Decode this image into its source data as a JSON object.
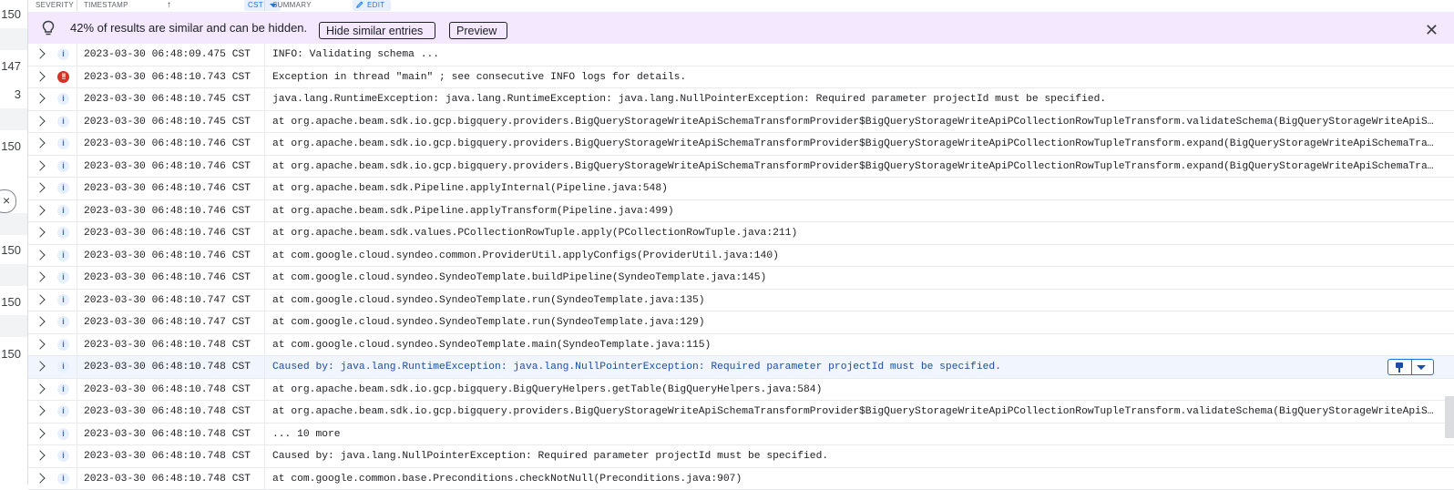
{
  "left_column": {
    "items": [
      "150",
      "147",
      "3",
      "150",
      "150",
      "150",
      "150"
    ],
    "close_glyph": "×"
  },
  "header": {
    "severity": "SEVERITY",
    "timestamp": "TIMESTAMP",
    "sort_glyph": "↑",
    "timezone": "CST",
    "summary": "SUMMARY",
    "edit": "EDIT"
  },
  "banner": {
    "text": "42% of results are similar and can be hidden.",
    "hide_label": "Hide similar entries",
    "preview_label": "Preview",
    "close_glyph": "✕"
  },
  "rows": [
    {
      "severity": "i",
      "timestamp": "2023-03-30 06:48:09.475 CST",
      "message": "INFO: Validating schema ..."
    },
    {
      "severity": "!!",
      "timestamp": "2023-03-30 06:48:10.743 CST",
      "message": "Exception in thread \"main\" ; see consecutive INFO logs for details."
    },
    {
      "severity": "i",
      "timestamp": "2023-03-30 06:48:10.745 CST",
      "message": "java.lang.RuntimeException: java.lang.RuntimeException: java.lang.NullPointerException: Required parameter projectId must be specified."
    },
    {
      "severity": "i",
      "timestamp": "2023-03-30 06:48:10.745 CST",
      "message": " at org.apache.beam.sdk.io.gcp.bigquery.providers.BigQueryStorageWriteApiSchemaTransformProvider$BigQueryStorageWriteApiPCollectionRowTupleTransform.validateSchema(BigQueryStorageWriteApiSche…"
    },
    {
      "severity": "i",
      "timestamp": "2023-03-30 06:48:10.746 CST",
      "message": " at org.apache.beam.sdk.io.gcp.bigquery.providers.BigQueryStorageWriteApiSchemaTransformProvider$BigQueryStorageWriteApiPCollectionRowTupleTransform.expand(BigQueryStorageWriteApiSchemaTransf…"
    },
    {
      "severity": "i",
      "timestamp": "2023-03-30 06:48:10.746 CST",
      "message": " at org.apache.beam.sdk.io.gcp.bigquery.providers.BigQueryStorageWriteApiSchemaTransformProvider$BigQueryStorageWriteApiPCollectionRowTupleTransform.expand(BigQueryStorageWriteApiSchemaTransf…"
    },
    {
      "severity": "i",
      "timestamp": "2023-03-30 06:48:10.746 CST",
      "message": " at org.apache.beam.sdk.Pipeline.applyInternal(Pipeline.java:548)"
    },
    {
      "severity": "i",
      "timestamp": "2023-03-30 06:48:10.746 CST",
      "message": " at org.apache.beam.sdk.Pipeline.applyTransform(Pipeline.java:499)"
    },
    {
      "severity": "i",
      "timestamp": "2023-03-30 06:48:10.746 CST",
      "message": " at org.apache.beam.sdk.values.PCollectionRowTuple.apply(PCollectionRowTuple.java:211)"
    },
    {
      "severity": "i",
      "timestamp": "2023-03-30 06:48:10.746 CST",
      "message": " at com.google.cloud.syndeo.common.ProviderUtil.applyConfigs(ProviderUtil.java:140)"
    },
    {
      "severity": "i",
      "timestamp": "2023-03-30 06:48:10.746 CST",
      "message": " at com.google.cloud.syndeo.SyndeoTemplate.buildPipeline(SyndeoTemplate.java:145)"
    },
    {
      "severity": "i",
      "timestamp": "2023-03-30 06:48:10.747 CST",
      "message": " at com.google.cloud.syndeo.SyndeoTemplate.run(SyndeoTemplate.java:135)"
    },
    {
      "severity": "i",
      "timestamp": "2023-03-30 06:48:10.747 CST",
      "message": " at com.google.cloud.syndeo.SyndeoTemplate.run(SyndeoTemplate.java:129)"
    },
    {
      "severity": "i",
      "timestamp": "2023-03-30 06:48:10.748 CST",
      "message": " at com.google.cloud.syndeo.SyndeoTemplate.main(SyndeoTemplate.java:115)"
    },
    {
      "severity": "i",
      "timestamp": "2023-03-30 06:48:10.748 CST",
      "message": "Caused by: java.lang.RuntimeException: java.lang.NullPointerException: Required parameter projectId must be specified."
    },
    {
      "severity": "i",
      "timestamp": "2023-03-30 06:48:10.748 CST",
      "message": " at org.apache.beam.sdk.io.gcp.bigquery.BigQueryHelpers.getTable(BigQueryHelpers.java:584)"
    },
    {
      "severity": "i",
      "timestamp": "2023-03-30 06:48:10.748 CST",
      "message": " at org.apache.beam.sdk.io.gcp.bigquery.providers.BigQueryStorageWriteApiSchemaTransformProvider$BigQueryStorageWriteApiPCollectionRowTupleTransform.validateSchema(BigQueryStorageWriteApiSche…"
    },
    {
      "severity": "i",
      "timestamp": "2023-03-30 06:48:10.748 CST",
      "message": " ... 10 more"
    },
    {
      "severity": "i",
      "timestamp": "2023-03-30 06:48:10.748 CST",
      "message": "Caused by: java.lang.NullPointerException: Required parameter projectId must be specified."
    },
    {
      "severity": "i",
      "timestamp": "2023-03-30 06:48:10.748 CST",
      "message": " at com.google.common.base.Preconditions.checkNotNull(Preconditions.java:907)"
    }
  ],
  "colors": {
    "accent": "#1a73e8",
    "banner_bg": "#f3e8fd",
    "error": "#d93025",
    "selected_row": "#f1f5fd"
  }
}
